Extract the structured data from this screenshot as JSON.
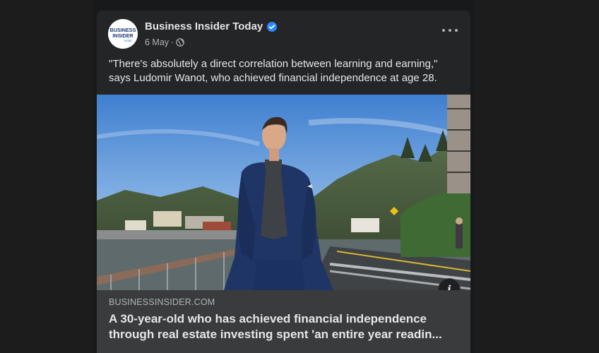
{
  "post": {
    "page_name": "Business Insider Today",
    "verified": true,
    "date": "6 May",
    "separator": "·",
    "audience_icon": "globe-icon",
    "more_icon": "more-options-icon",
    "text": "\"There's absolutely a direct correlation between learning and earning,\" says Ludomir Wanot, who achieved financial independence at age 28.",
    "avatar_logo_lines": [
      "BUSINESS",
      "INSIDER",
      "today"
    ]
  },
  "link_preview": {
    "domain": "BUSINESSINSIDER.COM",
    "title": "A 30-year-old who has achieved financial independence through real estate investing spent 'an entire year readin...",
    "info_icon": "info-icon"
  },
  "colors": {
    "background": "#1c1c1d",
    "card": "#242526",
    "link_preview_bg": "#3a3b3c",
    "verified_blue": "#2d88ff",
    "primary_text": "#e4e6eb",
    "secondary_text": "#b0b3b8"
  }
}
